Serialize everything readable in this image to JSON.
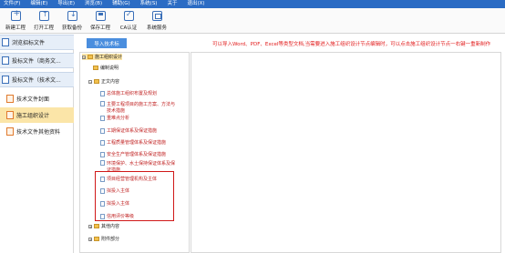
{
  "menu": [
    "文件(F)",
    "编辑(E)",
    "导出(E)",
    "浏览(B)",
    "辅助(G)",
    "系统(S)",
    "关于",
    "退出(X)"
  ],
  "toolbar": {
    "new": "新建工程",
    "open": "打开工程",
    "fetch": "获取备份",
    "save": "保存工程",
    "ca": "CA认证",
    "sys": "系统服务"
  },
  "sidebar": {
    "browse": "浏览招标文件",
    "bid_business": "投标文件（商务文...",
    "bid_tech": "投标文件（技术文...",
    "items": [
      "技术文件封面",
      "施工组织设计",
      "技术文件其他资料"
    ]
  },
  "main": {
    "import_label": "导入技术标",
    "notice": "可以导入Word、PDF、Excel等类型文档,当需要进入施工组织设计节点编辑时，可以点击施工组织设计节点一右键一重新制作"
  },
  "tree": {
    "root": "施工组织设计",
    "compile": "编制说明",
    "body": "正文内容",
    "items": [
      "总体施工组织布置及规划",
      "主要工程项目的施工方案、方法与技术措施",
      "重难点分析",
      "工期保证体系及保证措施",
      "工程质量管理体系及保证措施",
      "安全生产管理体系及保证措施",
      "环境保护、水土保持保证体系及保证措施",
      "项目经营管理机构及主体",
      "拟投入主体",
      "拟投入主体",
      "信用评价等级"
    ],
    "other": "其他内容",
    "attachment": "附件部分"
  }
}
